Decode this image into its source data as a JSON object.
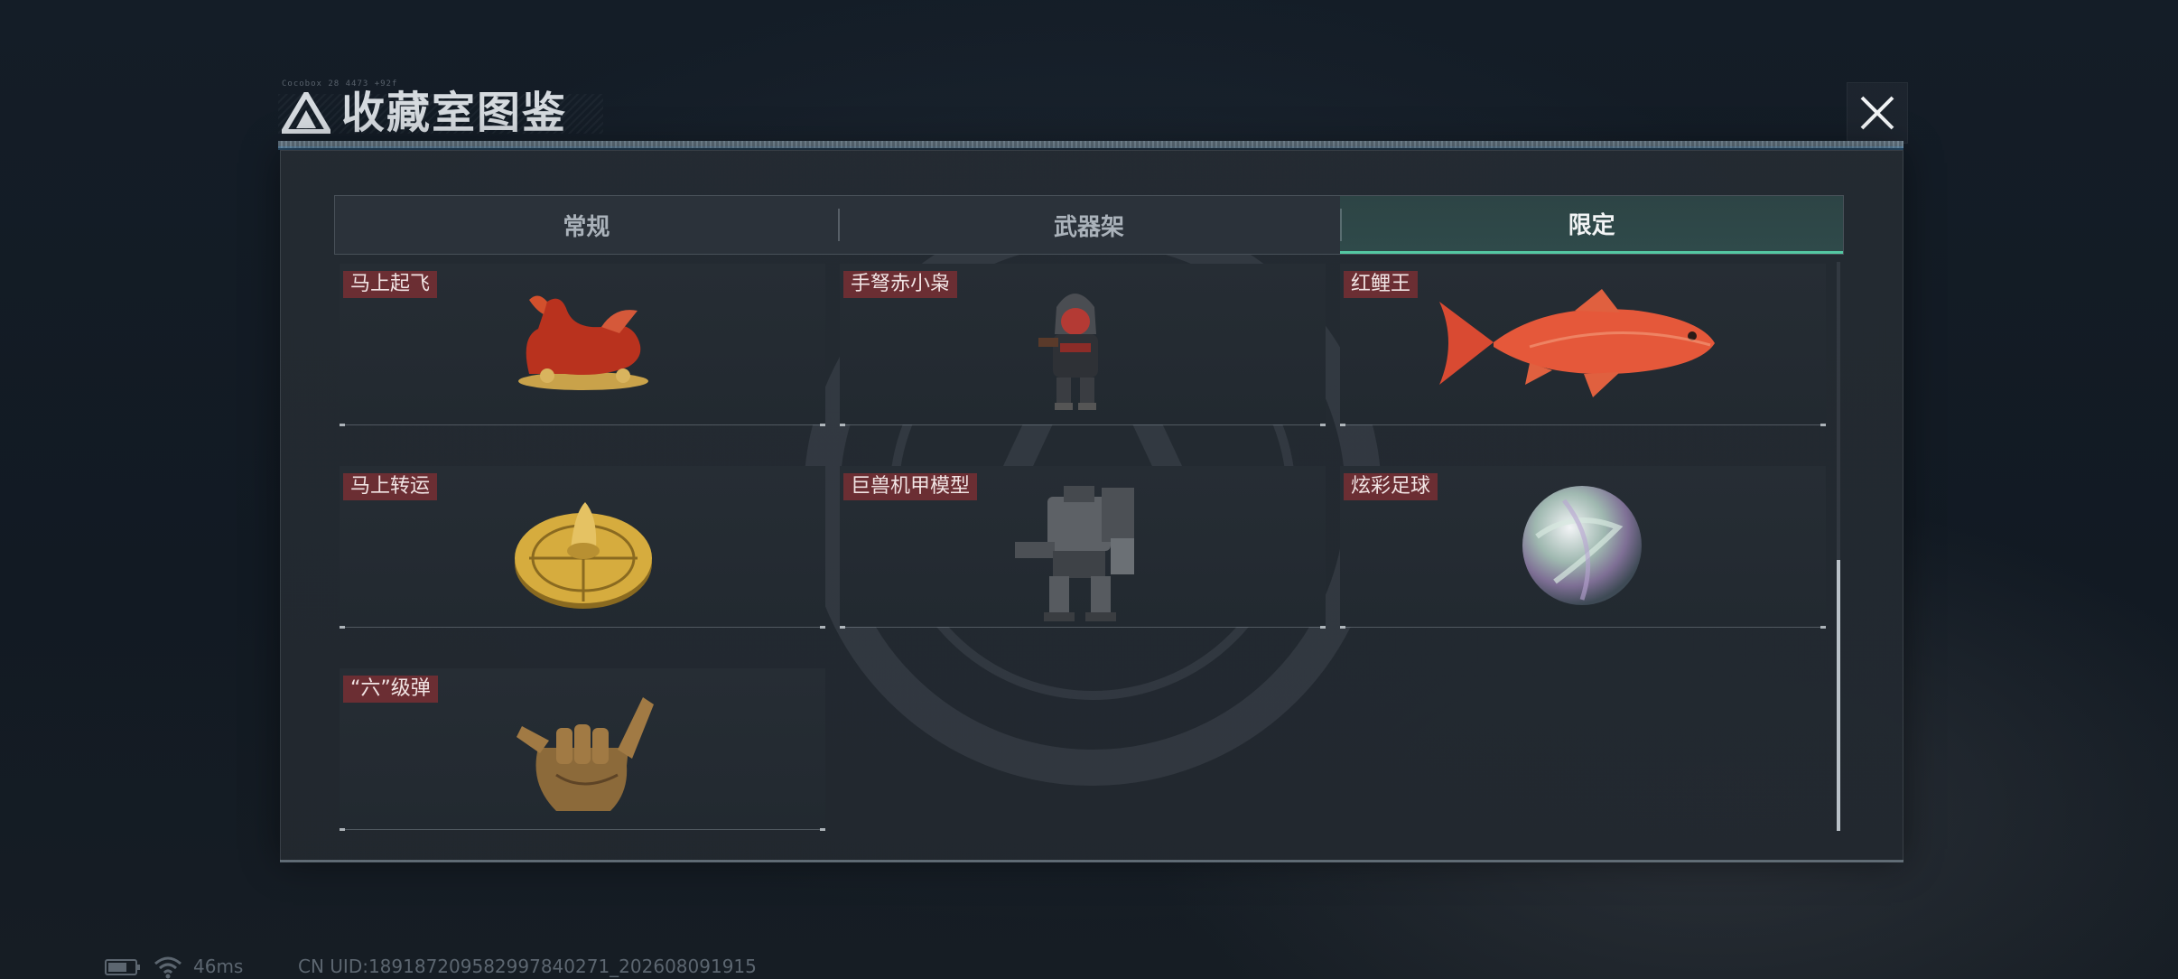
{
  "header": {
    "title": "收藏室图鉴",
    "deco_text": "Cocobox 28 4473 +92f",
    "logo_icon": "triangle-logo-icon",
    "close_icon": "close-icon"
  },
  "tabs": [
    {
      "label": "常规",
      "active": false
    },
    {
      "label": "武器架",
      "active": false
    },
    {
      "label": "限定",
      "active": true
    }
  ],
  "items": [
    {
      "label": "马上起飞",
      "icon": "red-horse-icon"
    },
    {
      "label": "手弩赤小枭",
      "icon": "hooded-figure-icon"
    },
    {
      "label": "红鲤王",
      "icon": "red-carp-icon"
    },
    {
      "label": "马上转运",
      "icon": "golden-wheel-icon"
    },
    {
      "label": "巨兽机甲模型",
      "icon": "mech-model-icon"
    },
    {
      "label": "炫彩足球",
      "icon": "iridescent-ball-icon"
    },
    {
      "label": "“六”级弹",
      "icon": "shaka-hand-icon"
    }
  ],
  "scrollbar": {
    "position_fraction": 1.0
  },
  "status": {
    "ping": "46ms",
    "uid": "CN UID:18918720958299784027​1_202608091915"
  },
  "colors": {
    "accent": "#54c7a2",
    "label_bg": "#6b2e33",
    "panel_bg": "#242b32"
  }
}
